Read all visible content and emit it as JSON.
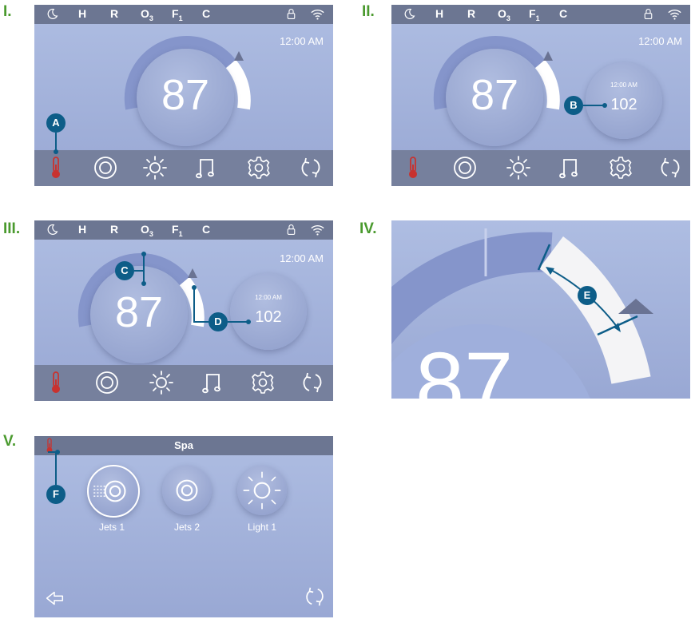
{
  "panels": [
    {
      "label": "I."
    },
    {
      "label": "II."
    },
    {
      "label": "III."
    },
    {
      "label": "IV."
    },
    {
      "label": "V."
    }
  ],
  "statusbar": {
    "heat_mode": "H",
    "r": "R",
    "ozone": "O",
    "ozone_sub": "3",
    "filter": "F",
    "filter_sub": "1",
    "cleanup": "C"
  },
  "clock": "12:00 AM",
  "temperature": "87",
  "set_temperature": "102",
  "setpoint_time": "12:00 AM",
  "callouts": {
    "a": "A",
    "b": "B",
    "c": "C",
    "d": "D",
    "e": "E",
    "f": "F"
  },
  "dial_closeup_digits": "87",
  "spa_screen": {
    "title": "Spa",
    "buttons": [
      {
        "label": "Jets 1",
        "icon": "jets-icon",
        "state": "on"
      },
      {
        "label": "Jets 2",
        "icon": "jets-icon",
        "state": "off"
      },
      {
        "label": "Light 1",
        "icon": "light-icon",
        "state": "off"
      }
    ]
  },
  "nav_icons": [
    "thermometer-icon",
    "jets-icon",
    "light-icon",
    "music-icon",
    "settings-icon",
    "refresh-icon"
  ],
  "colors": {
    "accent": "#0d5d88",
    "label_green": "#4a9a2e",
    "thermo_red": "#c8322f"
  }
}
